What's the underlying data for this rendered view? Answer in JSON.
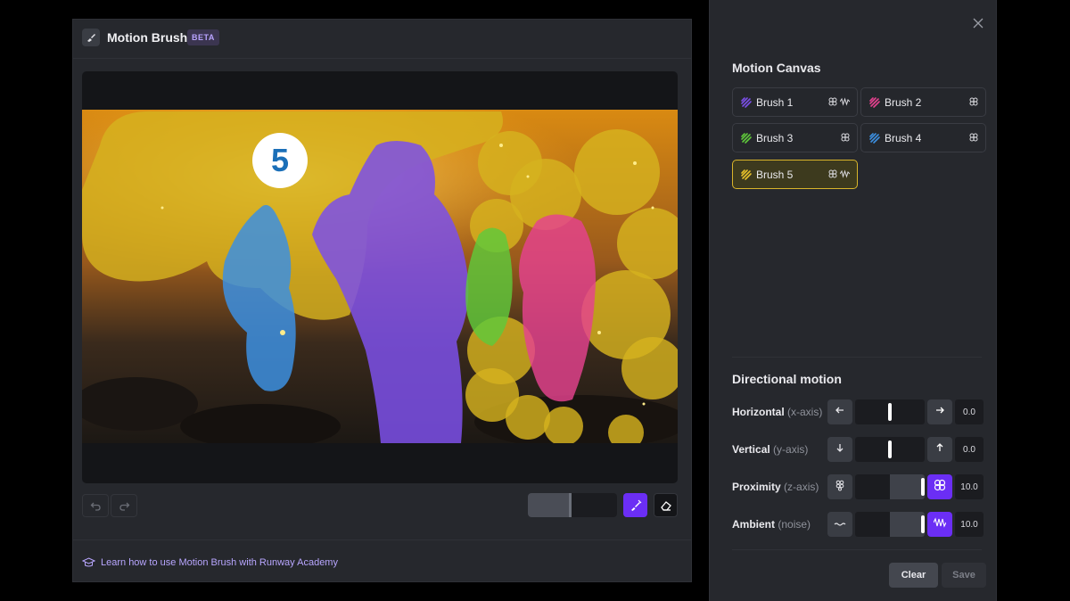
{
  "left_panel": {
    "title": "Motion Brush",
    "badge": "BETA",
    "active_brush_number": "5",
    "brush_size_fraction": 0.48,
    "academy_link": "Learn how to use Motion Brush with Runway Academy",
    "icons": {
      "app": "motion-brush-icon",
      "undo": "undo-icon",
      "redo": "redo-icon",
      "brush_tool": "brush-icon",
      "eraser_tool": "eraser-icon",
      "academy": "graduation-cap-icon"
    }
  },
  "right_panel": {
    "title": "Motion Canvas",
    "brushes": [
      {
        "label": "Brush 1",
        "color": "#7b4fe8",
        "marks": [
          "proximity-icon",
          "ambient-icon"
        ]
      },
      {
        "label": "Brush 2",
        "color": "#e5428f",
        "marks": [
          "proximity-icon"
        ]
      },
      {
        "label": "Brush 3",
        "color": "#5fc93b",
        "marks": [
          "proximity-icon"
        ]
      },
      {
        "label": "Brush 4",
        "color": "#3c8fe0",
        "marks": [
          "proximity-icon"
        ]
      },
      {
        "label": "Brush 5",
        "color": "#e8c12a",
        "marks": [
          "proximity-icon",
          "ambient-icon"
        ]
      }
    ],
    "active_brush": "Brush 5",
    "directional_title": "Directional motion",
    "motions": [
      {
        "label": "Horizontal",
        "sub": "(x-axis)",
        "value": "0.0",
        "level": 0.5,
        "left_icon": "arrow-left-icon",
        "right_icon": "arrow-right-icon",
        "right_active": false
      },
      {
        "label": "Vertical",
        "sub": "(y-axis)",
        "value": "0.0",
        "level": 0.5,
        "left_icon": "arrow-down-icon",
        "right_icon": "arrow-up-icon",
        "right_active": false
      },
      {
        "label": "Proximity",
        "sub": "(z-axis)",
        "value": "10.0",
        "level": 1.0,
        "left_icon": "proximity-small-icon",
        "right_icon": "proximity-large-icon",
        "right_active": true
      },
      {
        "label": "Ambient",
        "sub": "(noise)",
        "value": "10.0",
        "level": 1.0,
        "left_icon": "ambient-low-icon",
        "right_icon": "ambient-high-icon",
        "right_active": true
      }
    ],
    "clear_label": "Clear",
    "save_label": "Save",
    "close_icon": "close-icon"
  },
  "colors": {
    "accent": "#6b2ef5",
    "brush_purple": "#7b4fe8",
    "brush_pink": "#e5428f",
    "brush_green": "#5fc93b",
    "brush_blue": "#3c8fe0",
    "brush_yellow": "#e8c12a"
  }
}
